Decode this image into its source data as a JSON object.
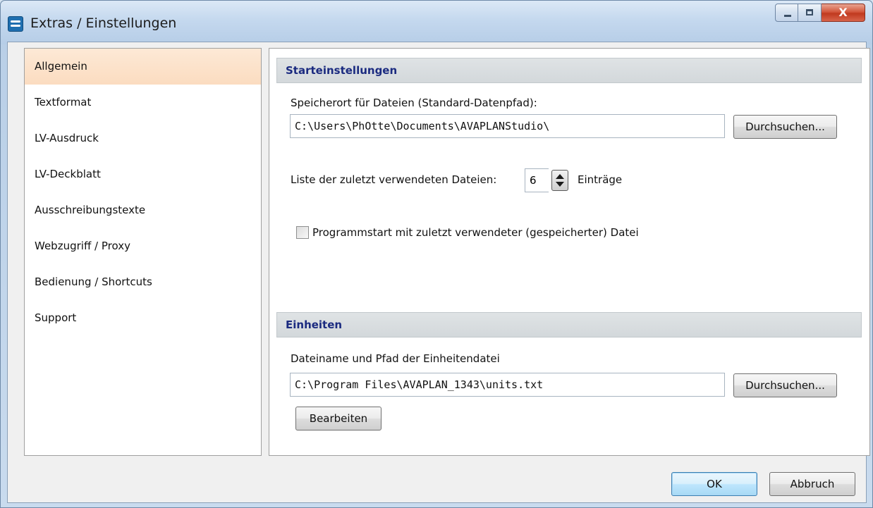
{
  "window": {
    "title": "Extras / Einstellungen",
    "close_glyph": "X"
  },
  "nav": {
    "items": [
      {
        "label": "Allgemein",
        "selected": true
      },
      {
        "label": "Textformat"
      },
      {
        "label": "LV-Ausdruck"
      },
      {
        "label": "LV-Deckblatt"
      },
      {
        "label": "Ausschreibungstexte"
      },
      {
        "label": "Webzugriff / Proxy"
      },
      {
        "label": "Bedienung / Shortcuts"
      },
      {
        "label": "Support"
      }
    ]
  },
  "start": {
    "header": "Starteinstellungen",
    "path_label": "Speicherort für Dateien (Standard-Datenpfad):",
    "path_value": "C:\\Users\\PhOtte\\Documents\\AVAPLANStudio\\",
    "browse_label": "Durchsuchen...",
    "recent_label": "Liste der zuletzt verwendeten Dateien:",
    "recent_value": "6",
    "recent_unit": "Einträge",
    "checkbox_label": "Programmstart mit zuletzt verwendeter (gespeicherter) Datei",
    "checkbox_checked": false
  },
  "units": {
    "header": "Einheiten",
    "file_label": "Dateiname und Pfad der Einheitendatei",
    "file_value": "C:\\Program Files\\AVAPLAN_1343\\units.txt",
    "browse_label": "Durchsuchen...",
    "edit_label": "Bearbeiten"
  },
  "footer": {
    "ok_label": "OK",
    "cancel_label": "Abbruch"
  }
}
